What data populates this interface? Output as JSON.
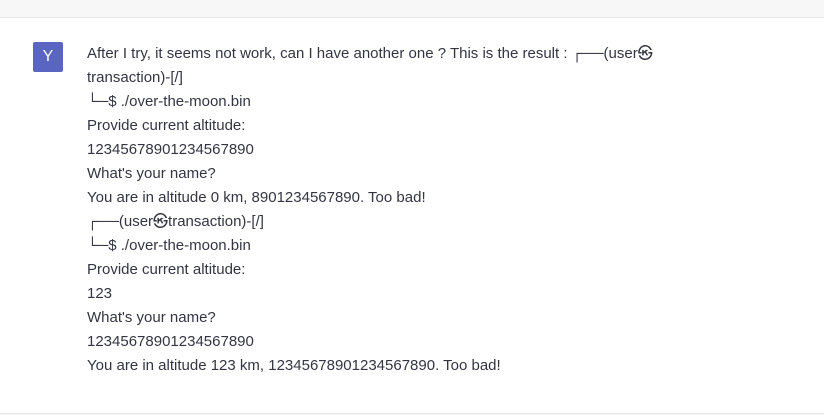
{
  "user": {
    "avatar_letter": "Y",
    "avatar_color": "#5a65c2"
  },
  "message": {
    "lines": [
      "After I try, it seems not work, can I have another one ? This is the result : ┌──(user㉿",
      "transaction)-[/]",
      "└─$ ./over-the-moon.bin",
      "Provide current altitude:",
      "12345678901234567890",
      "What's your name?",
      "You are in altitude 0 km, 8901234567890. Too bad!",
      "┌──(user㉿transaction)-[/]",
      "└─$ ./over-the-moon.bin",
      "Provide current altitude:",
      "123",
      "What's your name?",
      "12345678901234567890",
      "You are in altitude 123 km, 12345678901234567890. Too bad!"
    ]
  }
}
